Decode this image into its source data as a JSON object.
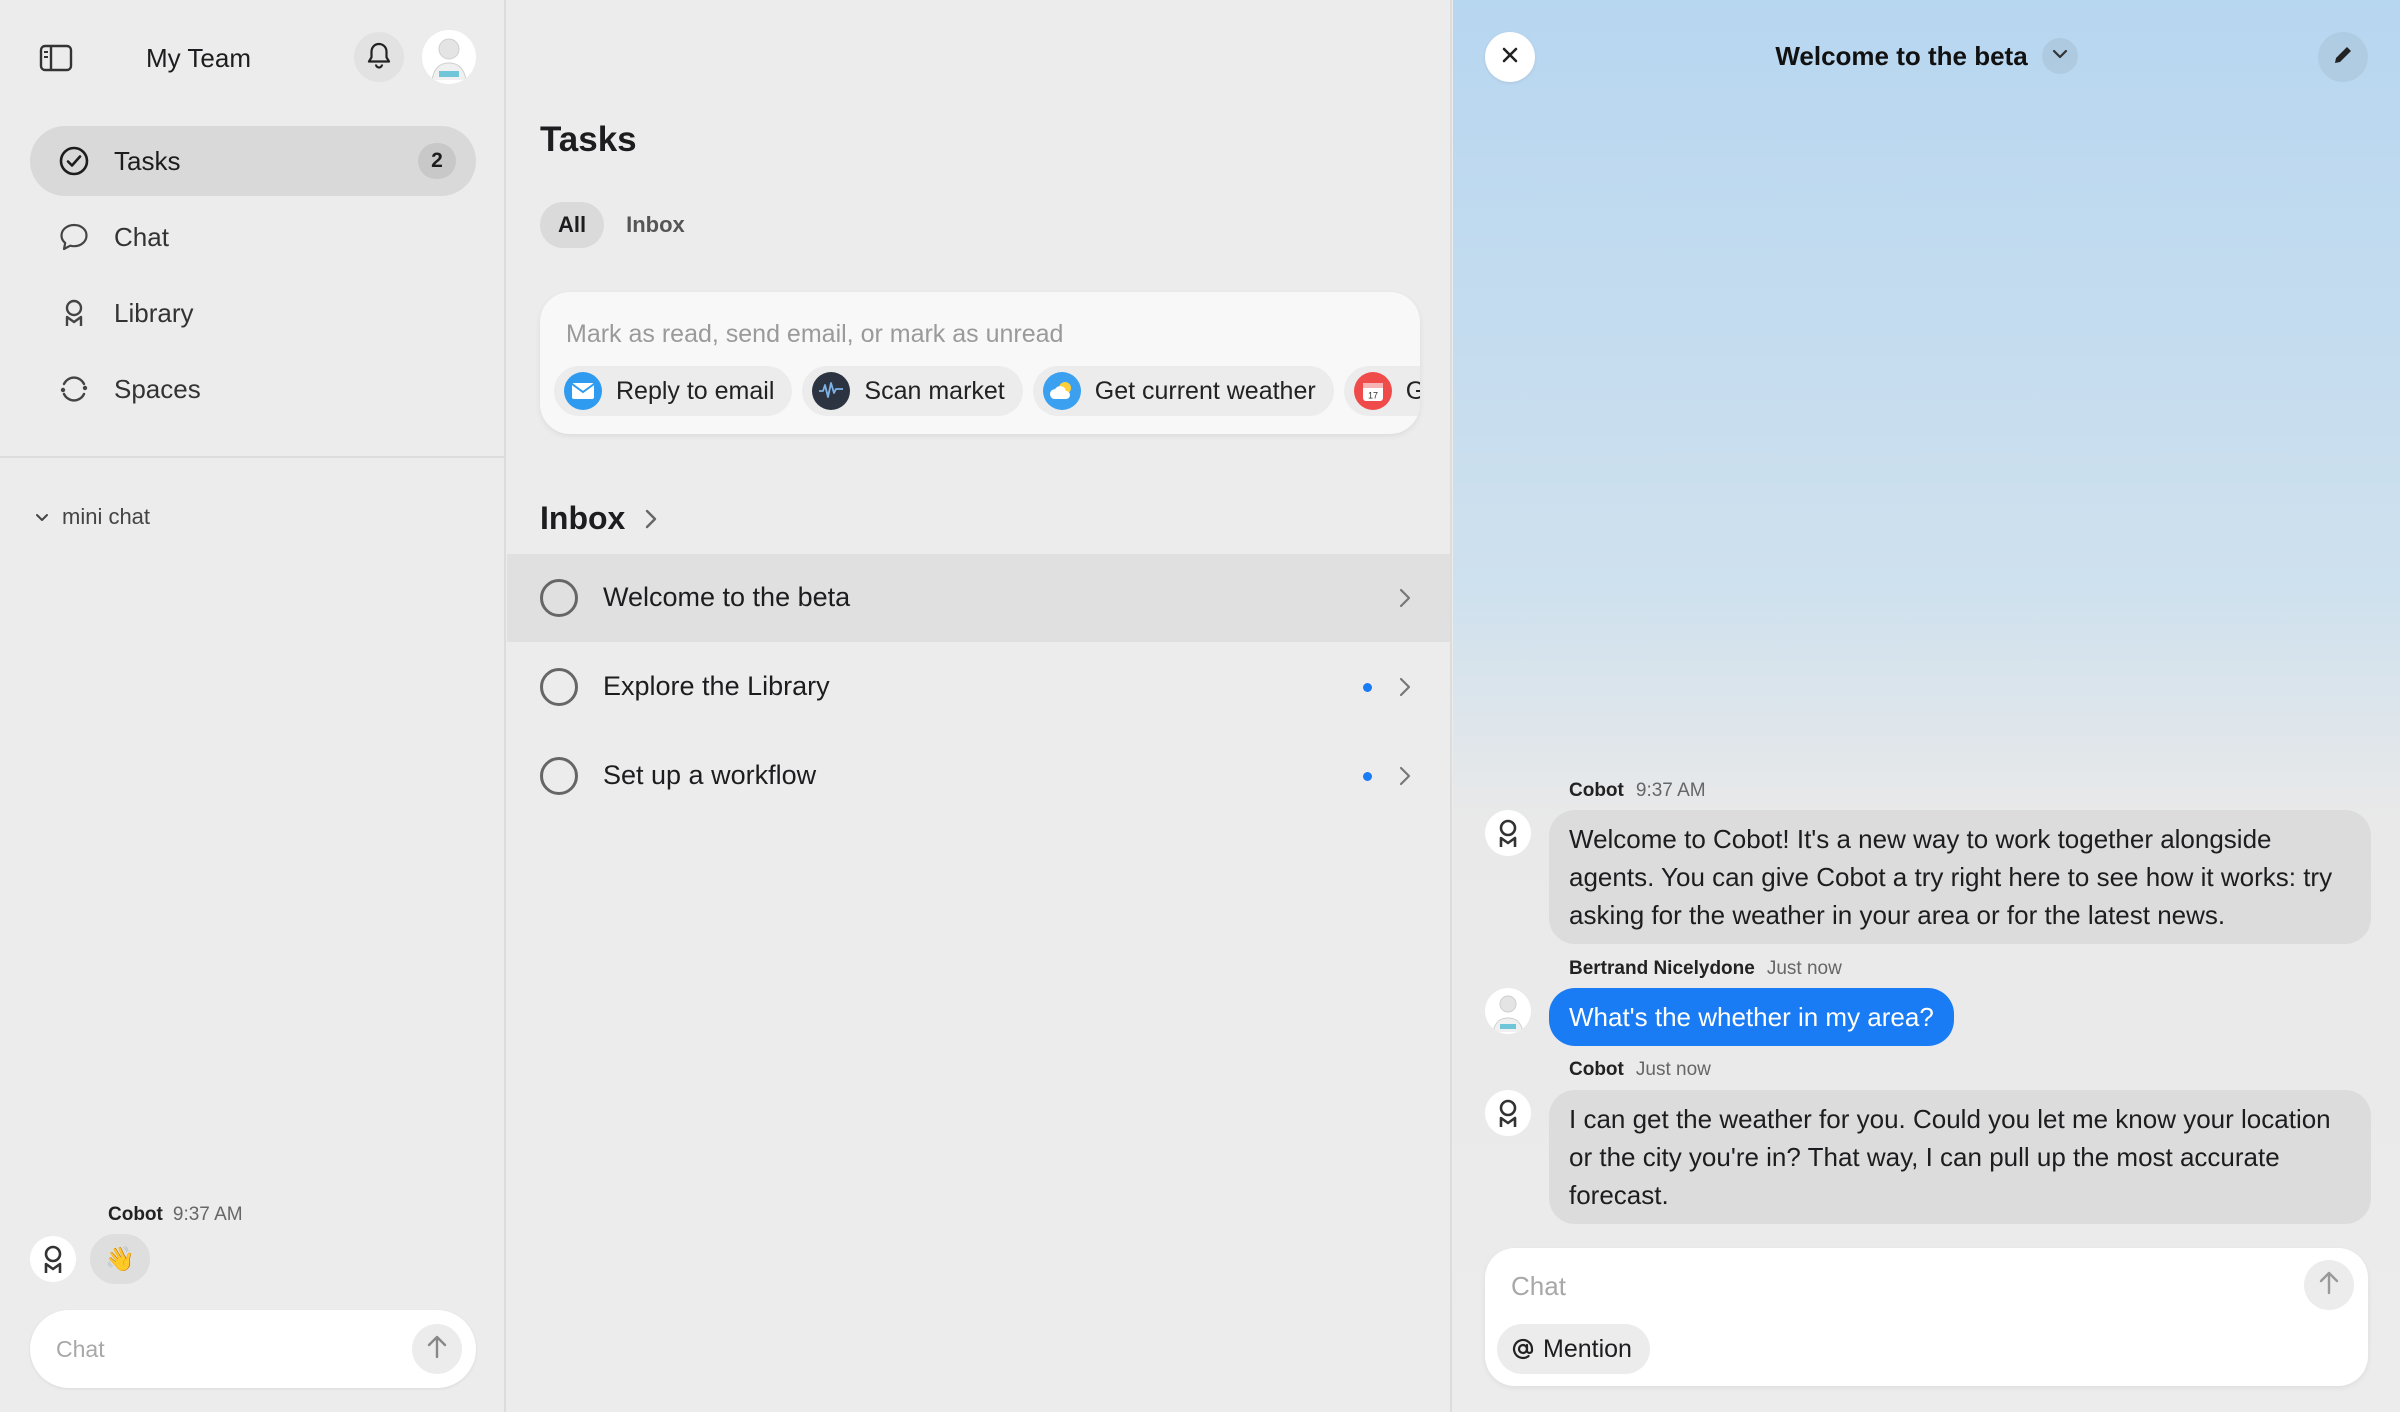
{
  "sidebar": {
    "team_name": "My Team",
    "toggle_icon": "sidebar-toggle-icon",
    "nav": [
      {
        "label": "Tasks",
        "icon": "check-circle-icon",
        "badge": "2",
        "active": true
      },
      {
        "label": "Chat",
        "icon": "speech-bubble-icon"
      },
      {
        "label": "Library",
        "icon": "person-icon"
      },
      {
        "label": "Spaces",
        "icon": "refresh-circle-icon"
      }
    ],
    "mini_chat": {
      "section_label": "mini chat",
      "last_message": {
        "author": "Cobot",
        "time": "9:37 AM",
        "content": "👋"
      },
      "input_placeholder": "Chat"
    }
  },
  "tasks": {
    "title": "Tasks",
    "filters": [
      {
        "label": "All",
        "active": true
      },
      {
        "label": "Inbox"
      }
    ],
    "command": {
      "placeholder": "Mark as read, send email, or mark as unread",
      "chips": [
        {
          "label": "Reply to email",
          "icon": "mail-icon"
        },
        {
          "label": "Scan market",
          "icon": "market-chart-icon"
        },
        {
          "label": "Get current weather",
          "icon": "weather-icon"
        },
        {
          "label": "Get e",
          "icon": "calendar-icon"
        }
      ]
    },
    "inbox": {
      "title": "Inbox",
      "items": [
        {
          "label": "Welcome to the beta",
          "selected": true,
          "unread": false
        },
        {
          "label": "Explore the Library",
          "unread": true
        },
        {
          "label": "Set up a workflow",
          "unread": true
        }
      ]
    }
  },
  "chat_panel": {
    "title": "Welcome to the beta",
    "messages": [
      {
        "author": "Cobot",
        "time": "9:37 AM",
        "text": "Welcome to Cobot! It's a new way to work together alongside agents. You can give Cobot a try right here to see how it works: try asking for the weather in your area or for the latest news."
      },
      {
        "author": "Bertrand Nicelydone",
        "time": "Just now",
        "text": "What's the whether in my area?",
        "from_user": true
      },
      {
        "author": "Cobot",
        "time": "Just now",
        "text": "I can get the weather for you. Could you let me know your location or the city you're in? That way, I can pull up the most accurate forecast."
      }
    ],
    "input_placeholder": "Chat",
    "mention_label": "Mention"
  },
  "colors": {
    "accent": "#1a7cf5",
    "background": "#ececec",
    "panel_gradient_top": "#b7d6f0"
  }
}
